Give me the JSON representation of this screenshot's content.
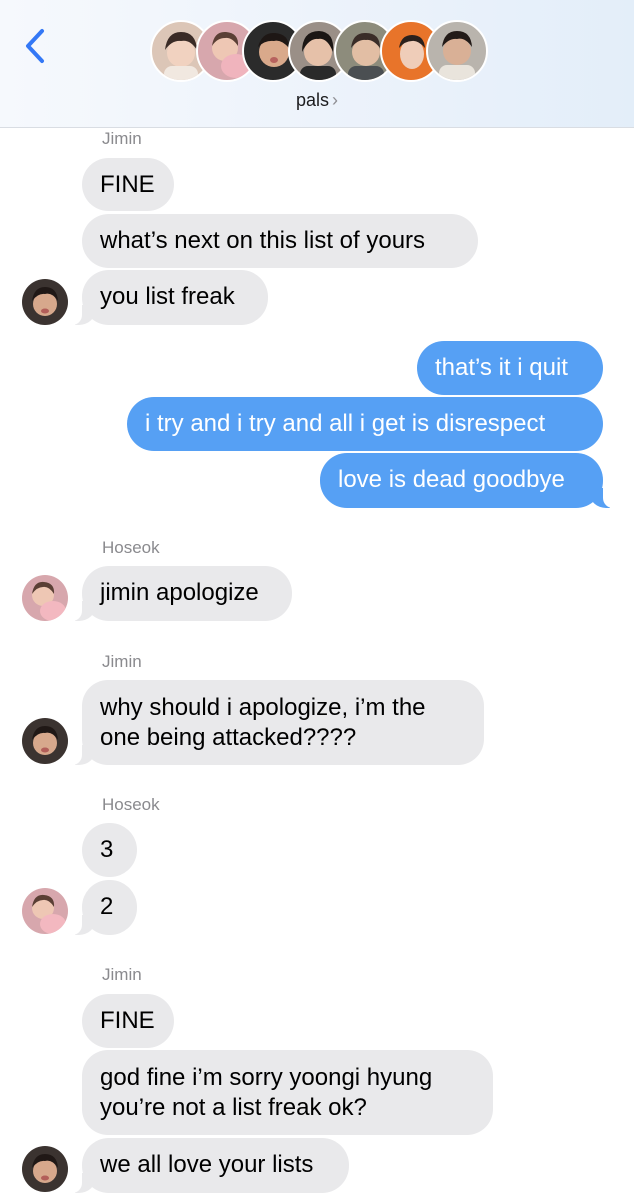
{
  "header": {
    "group_name": "pals",
    "chevron": "›",
    "back_icon": "chevron-left-icon",
    "accent_color": "#3478f6",
    "members": [
      {
        "photo": "member-1",
        "bg": "#dcc6b7",
        "skin": "#f1d2c0",
        "hair": "#3a2b26"
      },
      {
        "photo": "member-2",
        "bg": "#d7a7ad",
        "skin": "#eec7b4",
        "hair": "#5a3f35"
      },
      {
        "photo": "member-3",
        "bg": "#2b2b2b",
        "skin": "#d9a98b",
        "hair": "#1e1715"
      },
      {
        "photo": "member-4",
        "bg": "#9a8f87",
        "skin": "#e6c1a9",
        "hair": "#1b1614"
      },
      {
        "photo": "member-5",
        "bg": "#8d8c7c",
        "skin": "#e2bea4",
        "hair": "#3a2d28"
      },
      {
        "photo": "member-6",
        "bg": "#e8742a",
        "skin": "#efcdb9",
        "hair": "#2b211d"
      },
      {
        "photo": "member-7",
        "bg": "#b9b4ad",
        "skin": "#d9b096",
        "hair": "#231b18"
      }
    ]
  },
  "colors": {
    "incoming_bubble": "#e9e9eb",
    "outgoing_bubble": "#56a0f4"
  },
  "messages": [
    {
      "type": "sender",
      "text": "Jimin"
    },
    {
      "type": "in",
      "text": "FINE"
    },
    {
      "type": "in",
      "text": "what’s next on this list of yours"
    },
    {
      "type": "in",
      "text": "you list freak",
      "avatar": "jimin"
    },
    {
      "type": "out",
      "text": "that’s it i quit"
    },
    {
      "type": "out",
      "text": "i try and i try and all i get is disrespect"
    },
    {
      "type": "out",
      "text": "love is dead goodbye"
    },
    {
      "type": "sender",
      "text": "Hoseok"
    },
    {
      "type": "in",
      "text": "jimin apologize",
      "avatar": "hoseok"
    },
    {
      "type": "sender",
      "text": "Jimin"
    },
    {
      "type": "in",
      "text": "why should i apologize, i’m the one being attacked????",
      "avatar": "jimin"
    },
    {
      "type": "sender",
      "text": "Hoseok"
    },
    {
      "type": "in",
      "text": "3"
    },
    {
      "type": "in",
      "text": "2",
      "avatar": "hoseok"
    },
    {
      "type": "sender",
      "text": "Jimin"
    },
    {
      "type": "in",
      "text": "FINE"
    },
    {
      "type": "in",
      "text": "god fine i’m sorry yoongi hyung you’re not a list freak ok?"
    },
    {
      "type": "in",
      "text": "we all love your lists",
      "avatar": "jimin"
    }
  ]
}
